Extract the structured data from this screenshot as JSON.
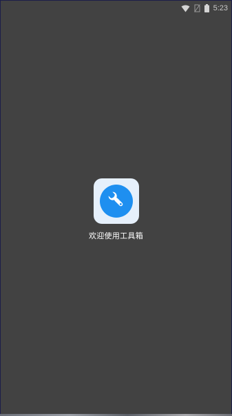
{
  "status_bar": {
    "time": "5:23",
    "icons": [
      "wifi-icon",
      "no-sim-icon",
      "battery-icon"
    ]
  },
  "splash": {
    "app_icon": "wrench-icon",
    "welcome_text": "欢迎使用工具箱",
    "accent_color": "#1e8ff0",
    "tile_color": "#e6f0fb"
  },
  "theme": {
    "background": "#424242"
  }
}
